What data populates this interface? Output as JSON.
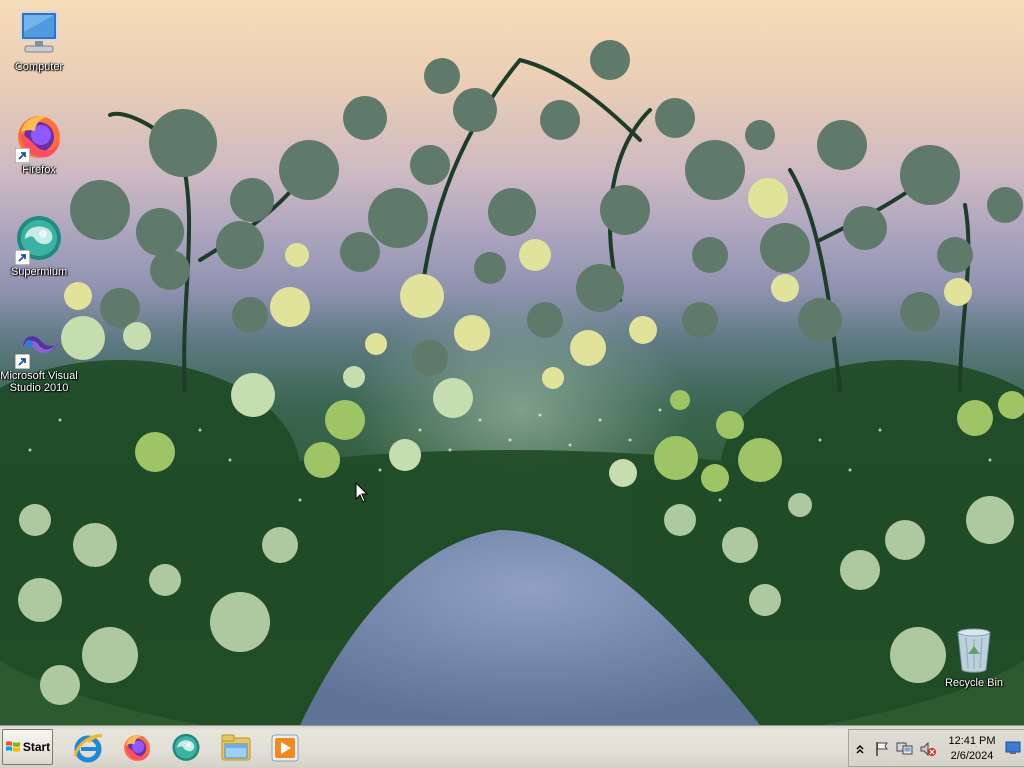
{
  "desktop": {
    "icons": [
      {
        "label": "Computer"
      },
      {
        "label": "Firefox"
      },
      {
        "label": "Supermium"
      },
      {
        "label": "Microsoft Visual Studio 2010"
      },
      {
        "label": "Recycle Bin"
      }
    ]
  },
  "taskbar": {
    "start_label": "Start",
    "pinned": [
      "internet-explorer-icon",
      "firefox-icon",
      "supermium-icon",
      "windows-explorer-icon",
      "media-player-icon"
    ],
    "clock": {
      "time": "12:41 PM",
      "date": "2/6/2024"
    }
  }
}
